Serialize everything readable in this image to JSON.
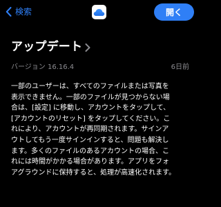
{
  "nav": {
    "back_label": "検索",
    "open_label": "開く",
    "app_icon": "icloud-icon"
  },
  "update": {
    "title": "アップデート",
    "version": "バージョン 16.16.4",
    "date": "6日前",
    "notes": "一部のユーザーは、すべてのファイルまたは写真を\n表示できません。一部のファイルが見つからない場\n合は、[設定] に移動し、アカウントをタップして、\n[アカウントのリセット] をタップしてください。こ\nれにより、アカウントが再同期されます。サインア\nウトしてもう一度サインインすると、問題も解決し\nます。多くのファイルのあるアカウントの場合、こ\nれには時間がかかる場合があります。アプリをフォ\nアグラウンドに保持すると、処理が高速化されます。"
  },
  "colors": {
    "background": "#000000",
    "accent": "#2f7ff6",
    "secondary_text": "#8c8c91",
    "primary_text": "#ffffff"
  }
}
